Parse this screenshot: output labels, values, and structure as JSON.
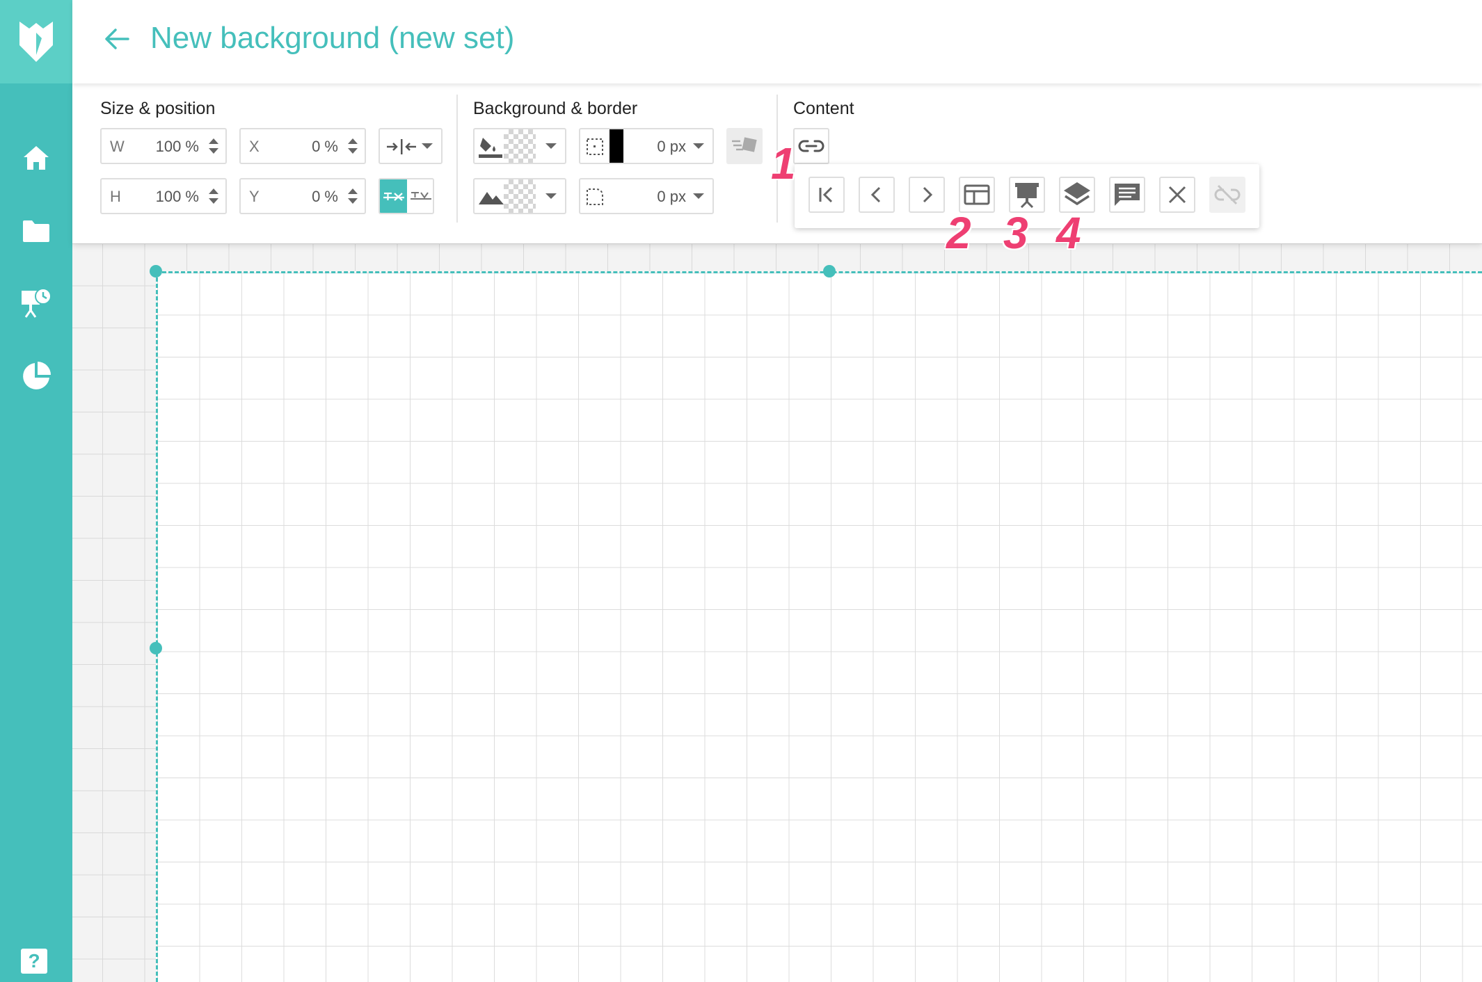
{
  "app": {
    "title": "New background (new set)"
  },
  "sidebar": {
    "items": [
      {
        "icon": "home-icon"
      },
      {
        "icon": "folder-icon"
      },
      {
        "icon": "presentation-clock-icon"
      },
      {
        "icon": "pie-chart-icon"
      }
    ],
    "help_label": "?"
  },
  "toolbar": {
    "size_position": {
      "title": "Size & position",
      "w_label": "W",
      "w_value": "100 %",
      "h_label": "H",
      "h_value": "100 %",
      "x_label": "X",
      "x_value": "0 %",
      "y_label": "Y",
      "y_value": "0 %"
    },
    "background_border": {
      "title": "Background & border",
      "border_width": "0 px",
      "border_radius": "0 px"
    },
    "content": {
      "title": "Content"
    }
  },
  "popup": {
    "buttons": [
      "first-page-icon",
      "previous-icon",
      "next-icon",
      "layout-icon",
      "presentation-icon",
      "layers-icon",
      "comment-icon",
      "close-icon",
      "unlink-icon"
    ]
  },
  "annotations": {
    "m1": "1",
    "m2": "2",
    "m3": "3",
    "m4": "4"
  },
  "colors": {
    "accent": "#45bfbb",
    "marker": "#ee3f72"
  }
}
